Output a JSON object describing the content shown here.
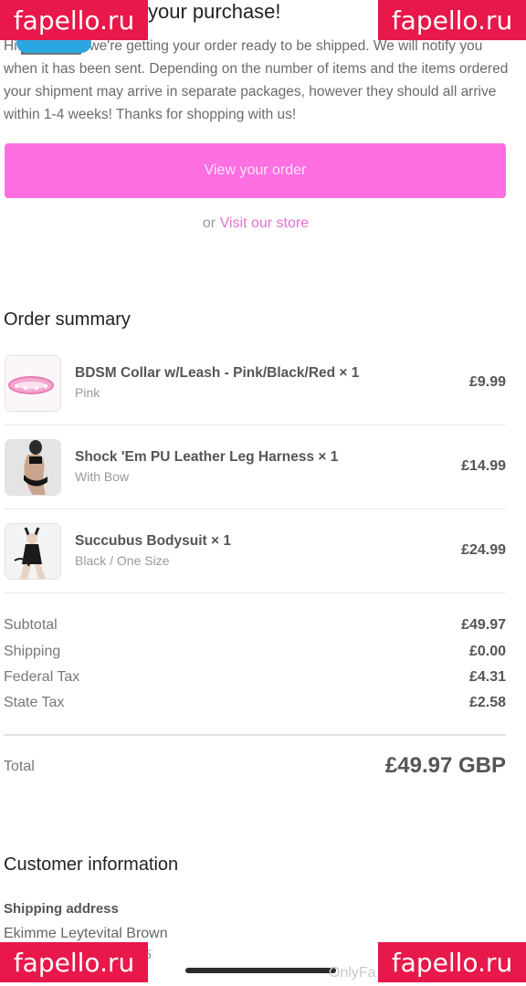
{
  "header": {
    "heading_fragment": "your purchase!",
    "intro": "Hi ██████, we're getting your order ready to be shipped. We will notify you when it has been sent. Depending on the number of items and the items ordered your shipment may arrive in separate packages, however they should all arrive within 1-4 weeks! Thanks for shopping with us!"
  },
  "actions": {
    "view_order": "View your order",
    "or": "or",
    "visit_store": "Visit our store"
  },
  "order_summary": {
    "title": "Order summary",
    "items": [
      {
        "title": "BDSM Collar w/Leash - Pink/Black/Red × 1",
        "variant": "Pink",
        "price": "£9.99"
      },
      {
        "title": "Shock 'Em PU Leather Leg Harness × 1",
        "variant": "With Bow",
        "price": "£14.99"
      },
      {
        "title": "Succubus Bodysuit × 1",
        "variant": "Black / One Size",
        "price": "£24.99"
      }
    ],
    "costs": [
      {
        "label": "Subtotal",
        "value": "£49.97"
      },
      {
        "label": "Shipping",
        "value": "£0.00"
      },
      {
        "label": "Federal Tax",
        "value": "£4.31"
      },
      {
        "label": "State Tax",
        "value": "£2.58"
      }
    ],
    "total_label": "Total",
    "total_value": "£49.97 GBP"
  },
  "customer": {
    "title": "Customer information",
    "shipping_label": "Shipping address",
    "name": "Ekimme Leytevital Brown",
    "line2": "5"
  },
  "watermark": {
    "badge": "fapello.ru",
    "corner_text": "OnlyFa"
  }
}
